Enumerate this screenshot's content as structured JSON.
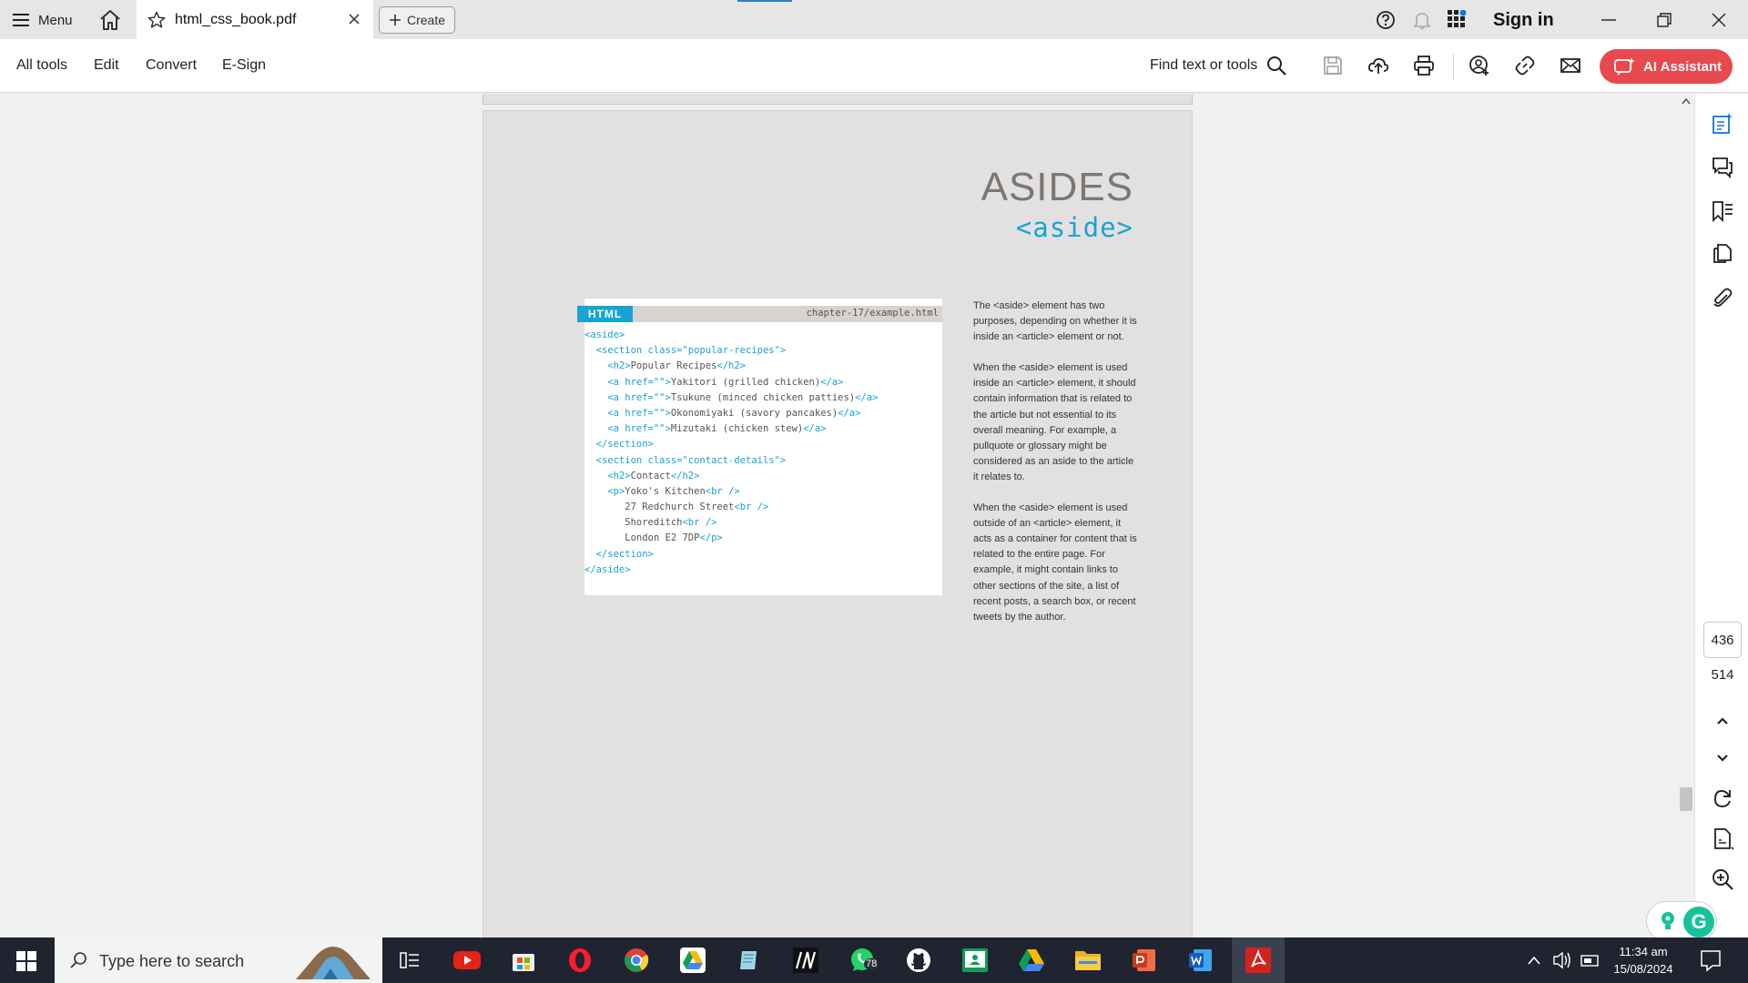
{
  "titlebar": {
    "menu_label": "Menu",
    "tab_title": "html_css_book.pdf",
    "create_label": "Create",
    "signin_label": "Sign in"
  },
  "toolbar": {
    "menus": [
      "All tools",
      "Edit",
      "Convert",
      "E-Sign"
    ],
    "find_label": "Find text or tools",
    "ai_label": "AI Assistant",
    "ai_color": "#e8494f",
    "icons": [
      "search-icon",
      "save-icon",
      "upload-cloud-icon",
      "print-icon",
      "share-user-icon",
      "link-icon",
      "mail-icon"
    ]
  },
  "left_rail": {
    "tools": [
      "select-arrow-icon",
      "add-comment-icon",
      "highlight-pen-icon",
      "lasso-draw-icon",
      "text-select-icon",
      "signature-icon"
    ]
  },
  "page": {
    "heading": "ASIDES",
    "subheading": "<aside>",
    "code_tag": "HTML",
    "code_file": "chapter-17/example.html",
    "code_lines": [
      [
        {
          "t": "t",
          "s": "<aside>"
        }
      ],
      [
        {
          "t": "t",
          "s": "  <section class=\"popular-recipes\">"
        }
      ],
      [
        {
          "t": "t",
          "s": "    <h2>"
        },
        {
          "t": "x",
          "s": "Popular Recipes"
        },
        {
          "t": "t",
          "s": "</h2>"
        }
      ],
      [
        {
          "t": "t",
          "s": "    <a href=\"\">"
        },
        {
          "t": "x",
          "s": "Yakitori (grilled chicken)"
        },
        {
          "t": "t",
          "s": "</a>"
        }
      ],
      [
        {
          "t": "t",
          "s": "    <a href=\"\">"
        },
        {
          "t": "x",
          "s": "Tsukune (minced chicken patties)"
        },
        {
          "t": "t",
          "s": "</a>"
        }
      ],
      [
        {
          "t": "t",
          "s": "    <a href=\"\">"
        },
        {
          "t": "x",
          "s": "Okonomiyaki (savory pancakes)"
        },
        {
          "t": "t",
          "s": "</a>"
        }
      ],
      [
        {
          "t": "t",
          "s": "    <a href=\"\">"
        },
        {
          "t": "x",
          "s": "Mizutaki (chicken stew)"
        },
        {
          "t": "t",
          "s": "</a>"
        }
      ],
      [
        {
          "t": "t",
          "s": "  </section>"
        }
      ],
      [
        {
          "t": "t",
          "s": "  <section class=\"contact-details\">"
        }
      ],
      [
        {
          "t": "t",
          "s": "    <h2>"
        },
        {
          "t": "x",
          "s": "Contact"
        },
        {
          "t": "t",
          "s": "</h2>"
        }
      ],
      [
        {
          "t": "t",
          "s": "    <p>"
        },
        {
          "t": "x",
          "s": "Yoko's Kitchen"
        },
        {
          "t": "t",
          "s": "<br />"
        }
      ],
      [
        {
          "t": "x",
          "s": "       27 Redchurch Street"
        },
        {
          "t": "t",
          "s": "<br />"
        }
      ],
      [
        {
          "t": "x",
          "s": "       Shoreditch"
        },
        {
          "t": "t",
          "s": "<br />"
        }
      ],
      [
        {
          "t": "x",
          "s": "       London E2 7DP"
        },
        {
          "t": "t",
          "s": "</p>"
        }
      ],
      [
        {
          "t": "t",
          "s": "  </section>"
        }
      ],
      [
        {
          "t": "t",
          "s": "</aside>"
        }
      ]
    ],
    "paragraphs": [
      "The <aside> element has two purposes, depending on whether it is inside an <article> element or not.",
      "When the <aside> element is used inside an <article> element, it should contain information that is related to the article but not essential to its overall meaning. For example, a pullquote or glossary might be considered as an aside to the article it relates to.",
      "When the <aside> element is used outside of an <article> element, it acts as a container for content that is related to the entire page. For example, it might contain links to other sections of the site, a list of recent posts, a search box, or recent tweets by the author."
    ]
  },
  "right_rail": {
    "icons": [
      "edit-sparkle-icon",
      "comments-icon",
      "bookmark-list-icon",
      "pages-icon",
      "attachment-icon",
      "chevron-up-icon",
      "chevron-down-icon",
      "rotate-icon",
      "page-fit-icon",
      "zoom-in-icon"
    ],
    "current_page": "436",
    "total_pages": "514"
  },
  "taskbar": {
    "search_placeholder": "Type here to search",
    "apps": [
      "task-view-icon",
      "youtube-icon",
      "microsoft-store-icon",
      "opera-icon",
      "chrome-icon",
      "google-drive-app-icon",
      "notepad-icon",
      "minitab-icon",
      "whatsapp-icon",
      "github-icon",
      "classroom-icon",
      "google-drive-icon",
      "file-explorer-icon",
      "powerpoint-icon",
      "word-icon",
      "acrobat-icon"
    ],
    "whatsapp_badge": "78",
    "time": "11:34 am",
    "date": "15/08/2024"
  }
}
